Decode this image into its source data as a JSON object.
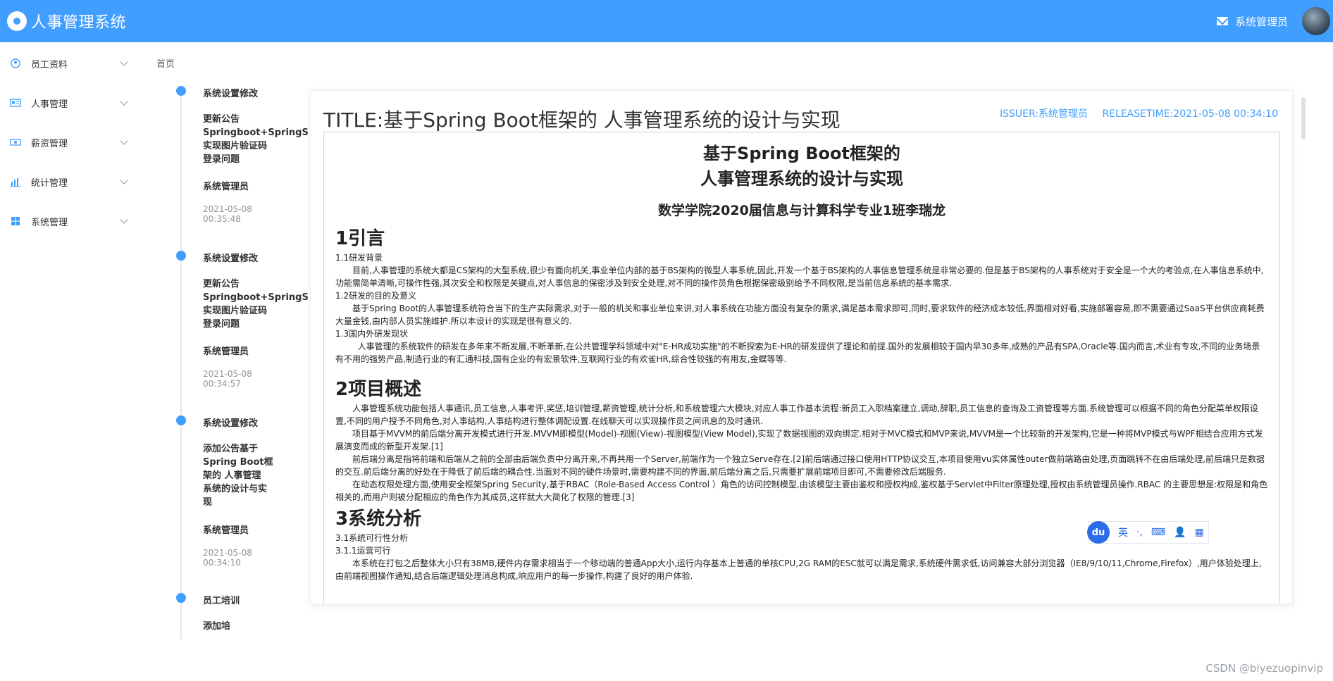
{
  "header": {
    "title": "人事管理系统",
    "user": "系统管理员"
  },
  "sidebar": {
    "items": [
      {
        "label": "员工资料",
        "icon": "user-circle-icon"
      },
      {
        "label": "人事管理",
        "icon": "id-card-icon"
      },
      {
        "label": "薪资管理",
        "icon": "money-icon"
      },
      {
        "label": "统计管理",
        "icon": "bar-chart-icon"
      },
      {
        "label": "系统管理",
        "icon": "windows-icon"
      }
    ]
  },
  "breadcrumb": "首页",
  "timeline": [
    {
      "title": "系统设置修改",
      "content": [
        "更新公告",
        "Springboot+SpringSe",
        "实现图片验证码",
        "登录问题"
      ],
      "author": "系统管理员",
      "time": [
        "2021-05-08",
        "00:35:48"
      ]
    },
    {
      "title": "系统设置修改",
      "content": [
        "更新公告",
        "Springboot+SpringSe",
        "实现图片验证码",
        "登录问题"
      ],
      "author": "系统管理员",
      "time": [
        "2021-05-08",
        "00:34:57"
      ]
    },
    {
      "title": "系统设置修改",
      "content": [
        "添加公告基于",
        "Spring Boot框",
        "架的 人事管理",
        "系统的设计与实",
        "现"
      ],
      "author": "系统管理员",
      "time": [
        "2021-05-08",
        "00:34:10"
      ]
    },
    {
      "title": "员工培训",
      "content": [
        "添加培"
      ],
      "author": "",
      "time": []
    }
  ],
  "notice": {
    "title": "TITLE:基于Spring Boot框架的 人事管理系统的设计与实现",
    "issuer": "ISSUER:系统管理员",
    "release": "RELEASETIME:2021-05-08 00:34:10",
    "doc": {
      "heading1": "基于Spring Boot框架的",
      "heading2": "人事管理系统的设计与实现",
      "author_line": "数学学院2020届信息与计算科学专业1班李瑞龙",
      "sections": [
        {
          "title": "1引言",
          "blocks": [
            {
              "type": "sub",
              "text": "1.1研发背景"
            },
            {
              "type": "p",
              "text": "目前,人事管理的系统大都是CS架构的大型系统,很少有面向机关,事业单位内部的基于BS架构的微型人事系统,因此,开发一个基于BS架构的人事信息管理系统是非常必要的.但是基于BS架构的人事系统对于安全是一个大的考验点,在人事信息系统中,功能需简单清晰,可操作性强,其次安全和权限是关键点,对人事信息的保密涉及到安全处理,对不同的操作员角色根据保密级别给予不同权限,是当前信息系统的基本需求."
            },
            {
              "type": "sub",
              "text": "1.2研发的目的及意义"
            },
            {
              "type": "p",
              "text": "基于Spring Boot的人事管理系统符合当下的生产实际需求,对于一般的机关和事业单位来讲,对人事系统在功能方面没有复杂的需求,满足基本需求即可,同时,要求软件的经济成本较低,界面相对好看,实施部署容易,即不需要通过SaaS平台供应商耗费大量金钱,由内部人员实施维护.所以本设计的实现是很有意义的."
            },
            {
              "type": "sub",
              "text": "1.3国内外研发现状"
            },
            {
              "type": "p",
              "text": "  人事管理的系统软件的研发在多年来不断发展,不断革新,在公共管理学科领域中对\"E-HR成功实施\"的不断探索为E-HR的研发提供了理论和前提.国外的发展相较于国内早30多年,成熟的产品有SPA,Oracle等.国内而言,术业有专攻,不同的业务场景有不用的强势产品,制造行业的有汇通科技,国有企业的有宏景软件,互联网行业的有欢雀HR,综合性较强的有用友,金蝶等等."
            }
          ]
        },
        {
          "title": "2项目概述",
          "blocks": [
            {
              "type": "p",
              "text": "人事管理系统功能包括人事通讯,员工信息,人事考评,奖惩,培训管理,薪资管理,统计分析,和系统管理六大模块,对应人事工作基本流程:新员工入职档案建立,调动,辞职,员工信息的查询及工资管理等方面.系统管理可以根据不同的角色分配菜单权限设置,不同的用户授予不同角色,对人事结构,人事结构进行整体调配设置.在线聊天可以实现操作员之间讯息的及时通讯."
            },
            {
              "type": "p",
              "text": "项目基于MVVM的前后端分离开发模式进行开发.MVVM即模型(Model)-视图(View)-视图模型(View Model),实现了数据视图的双向绑定.相对于MVC模式和MVP来说,MVVM是一个比较新的开发架构,它是一种将MVP模式与WPF相结合应用方式发展演变而成的新型开发架.[1]"
            },
            {
              "type": "p",
              "text": "前后端分离是指将前端和后端从之前的全部由后端负责中分离开来,不再共用一个Server,前端作为一个独立Serve存在.[2]前后端通过接口使用HTTP协议交互,本项目使用vu实体属性outer做前端路由处理,页面跳转不在由后端处理,前后端只是数据的交互.前后端分离的好处在于降低了前后端的耦合性.当面对不同的硬件场景时,需要构建不同的界面,前后端分离之后,只需要扩展前端项目即可,不需要修改后端服务."
            },
            {
              "type": "p",
              "text": "在动态权限处理方面,使用安全框架Spring Security,基于RBAC（Role-Based Access Control ）角色的访问控制模型,由该模型主要由鉴权和授权构成,鉴权基于Servlet中Filter原理处理,授权由系统管理员操作.RBAC 的主要思想是:权限是和角色相关的,而用户则被分配相应的角色作为其成员,这样就大大简化了权限的管理.[3]"
            }
          ]
        },
        {
          "title": "3系统分析",
          "blocks": [
            {
              "type": "sub",
              "text": "3.1系统可行性分析"
            },
            {
              "type": "sub",
              "text": "3.1.1运营可行"
            },
            {
              "type": "p",
              "text": "本系统在打包之后整体大小只有38MB,硬件内存需求相当于一个移动端的普通App大小,运行内存基本上普通的单核CPU,2G RAM的ESC就可以满足需求,系统硬件需求低,访问兼容大部分浏览器（IE8/9/10/11,Chrome,Firefox）,用户体验处理上,由前端视图操作通知,结合后端逻辑处理消息构成,响应用户的每一步操作,构建了良好的用户体验."
            }
          ]
        }
      ]
    }
  },
  "ime": {
    "logo": "du",
    "items": [
      "英",
      "·,",
      "⌨",
      "👤",
      "▦"
    ]
  },
  "watermark": "CSDN @biyezuopinvip",
  "colors": {
    "accent": "#409eff",
    "text": "#303133",
    "muted": "#909399"
  }
}
